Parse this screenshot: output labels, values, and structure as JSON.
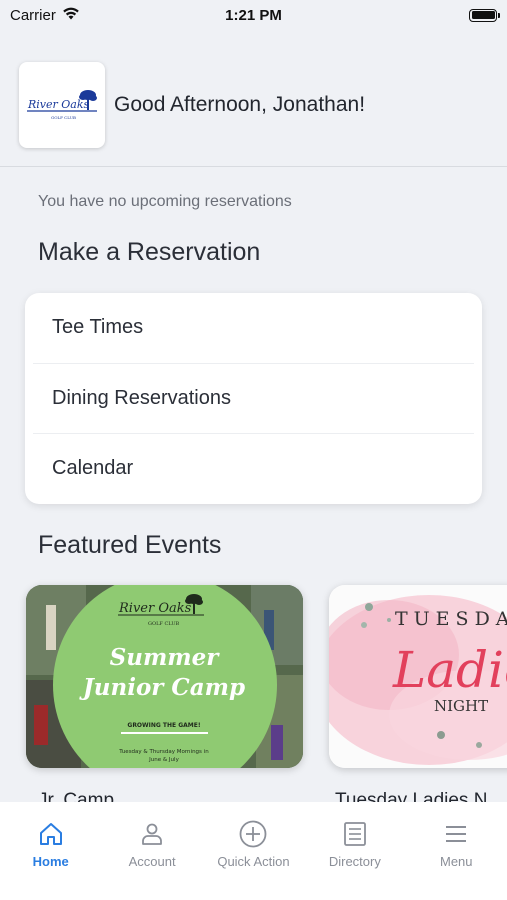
{
  "status_bar": {
    "carrier": "Carrier",
    "time": "1:21 PM"
  },
  "header": {
    "greeting": "Good Afternoon, Jonathan!",
    "logo_text": "River Oaks",
    "logo_sub": "GOLF CLUB"
  },
  "reservations": {
    "empty_message": "You have no upcoming reservations",
    "section_title": "Make a Reservation",
    "items": [
      {
        "label": "Tee Times"
      },
      {
        "label": "Dining Reservations"
      },
      {
        "label": "Calendar"
      }
    ]
  },
  "featured": {
    "section_title": "Featured Events",
    "events": [
      {
        "label": "Jr. Camp",
        "poster": {
          "logo": "River Oaks",
          "logo_sub": "GOLF CLUB",
          "line1": "Summer",
          "line2": "Junior Camp",
          "tagline": "GROWING THE GAME!",
          "schedule1": "Tuesday & Thursday Mornings in",
          "schedule2": "June & July"
        }
      },
      {
        "label": "Tuesday Ladies N",
        "poster": {
          "line1": "TUESDA",
          "line2": "Ladie",
          "line3": "NIGHT"
        }
      }
    ]
  },
  "tabs": [
    {
      "label": "Home",
      "icon": "home-icon",
      "active": true
    },
    {
      "label": "Account",
      "icon": "account-icon",
      "active": false
    },
    {
      "label": "Quick Action",
      "icon": "plus-circle-icon",
      "active": false
    },
    {
      "label": "Directory",
      "icon": "directory-icon",
      "active": false
    },
    {
      "label": "Menu",
      "icon": "menu-icon",
      "active": false
    }
  ],
  "colors": {
    "accent": "#2a7de1",
    "logo_blue": "#1b3a9a",
    "tab_inactive": "#8b8f98"
  }
}
